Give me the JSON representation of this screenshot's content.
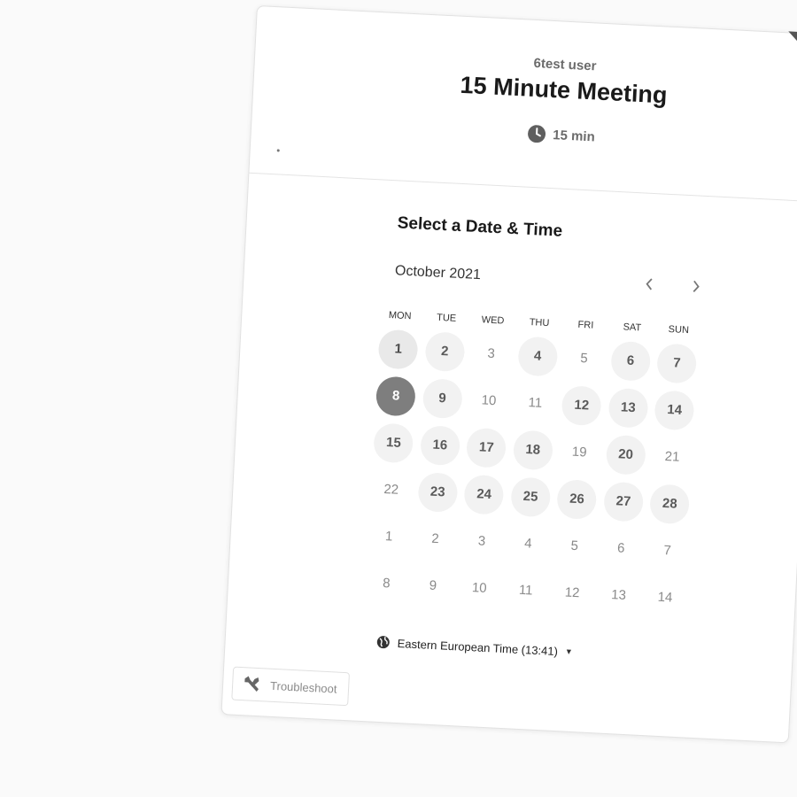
{
  "header": {
    "user_name": "6test user",
    "event_title": "15 Minute Meeting",
    "duration": "15 min",
    "duration_icon": "clock-icon"
  },
  "scheduler": {
    "title": "Select a Date & Time",
    "month": "October 2021",
    "prev_icon": "chevron-left-icon",
    "next_icon": "chevron-right-icon",
    "weekdays": [
      "MON",
      "TUE",
      "WED",
      "THU",
      "FRI",
      "SAT",
      "SUN"
    ],
    "days": [
      {
        "label": "1",
        "state": "selected"
      },
      {
        "label": "2",
        "state": "available"
      },
      {
        "label": "3",
        "state": "unavailable"
      },
      {
        "label": "4",
        "state": "available"
      },
      {
        "label": "5",
        "state": "unavailable"
      },
      {
        "label": "6",
        "state": "available"
      },
      {
        "label": "7",
        "state": "available"
      },
      {
        "label": "8",
        "state": "today"
      },
      {
        "label": "9",
        "state": "available"
      },
      {
        "label": "10",
        "state": "unavailable"
      },
      {
        "label": "11",
        "state": "unavailable"
      },
      {
        "label": "12",
        "state": "available"
      },
      {
        "label": "13",
        "state": "available"
      },
      {
        "label": "14",
        "state": "available"
      },
      {
        "label": "15",
        "state": "available"
      },
      {
        "label": "16",
        "state": "available"
      },
      {
        "label": "17",
        "state": "available"
      },
      {
        "label": "18",
        "state": "available"
      },
      {
        "label": "19",
        "state": "unavailable"
      },
      {
        "label": "20",
        "state": "available"
      },
      {
        "label": "21",
        "state": "unavailable"
      },
      {
        "label": "22",
        "state": "unavailable"
      },
      {
        "label": "23",
        "state": "available"
      },
      {
        "label": "24",
        "state": "available"
      },
      {
        "label": "25",
        "state": "available"
      },
      {
        "label": "26",
        "state": "available"
      },
      {
        "label": "27",
        "state": "available"
      },
      {
        "label": "28",
        "state": "available"
      },
      {
        "label": "1",
        "state": "unavailable"
      },
      {
        "label": "2",
        "state": "unavailable"
      },
      {
        "label": "3",
        "state": "unavailable"
      },
      {
        "label": "4",
        "state": "unavailable"
      },
      {
        "label": "5",
        "state": "unavailable"
      },
      {
        "label": "6",
        "state": "unavailable"
      },
      {
        "label": "7",
        "state": "unavailable"
      },
      {
        "label": "8",
        "state": "unavailable"
      },
      {
        "label": "9",
        "state": "unavailable"
      },
      {
        "label": "10",
        "state": "unavailable"
      },
      {
        "label": "11",
        "state": "unavailable"
      },
      {
        "label": "12",
        "state": "unavailable"
      },
      {
        "label": "13",
        "state": "unavailable"
      },
      {
        "label": "14",
        "state": "unavailable"
      }
    ],
    "timezone_label": "Eastern European Time (13:41)",
    "timezone_icon": "globe-icon"
  },
  "footer": {
    "troubleshoot_label": "Troubleshoot",
    "troubleshoot_icon": "wrench-icon"
  },
  "colors": {
    "today_bg": "#7e7e7e",
    "available_bg": "#f2f2f2",
    "text_dark": "#1a1a1a"
  }
}
